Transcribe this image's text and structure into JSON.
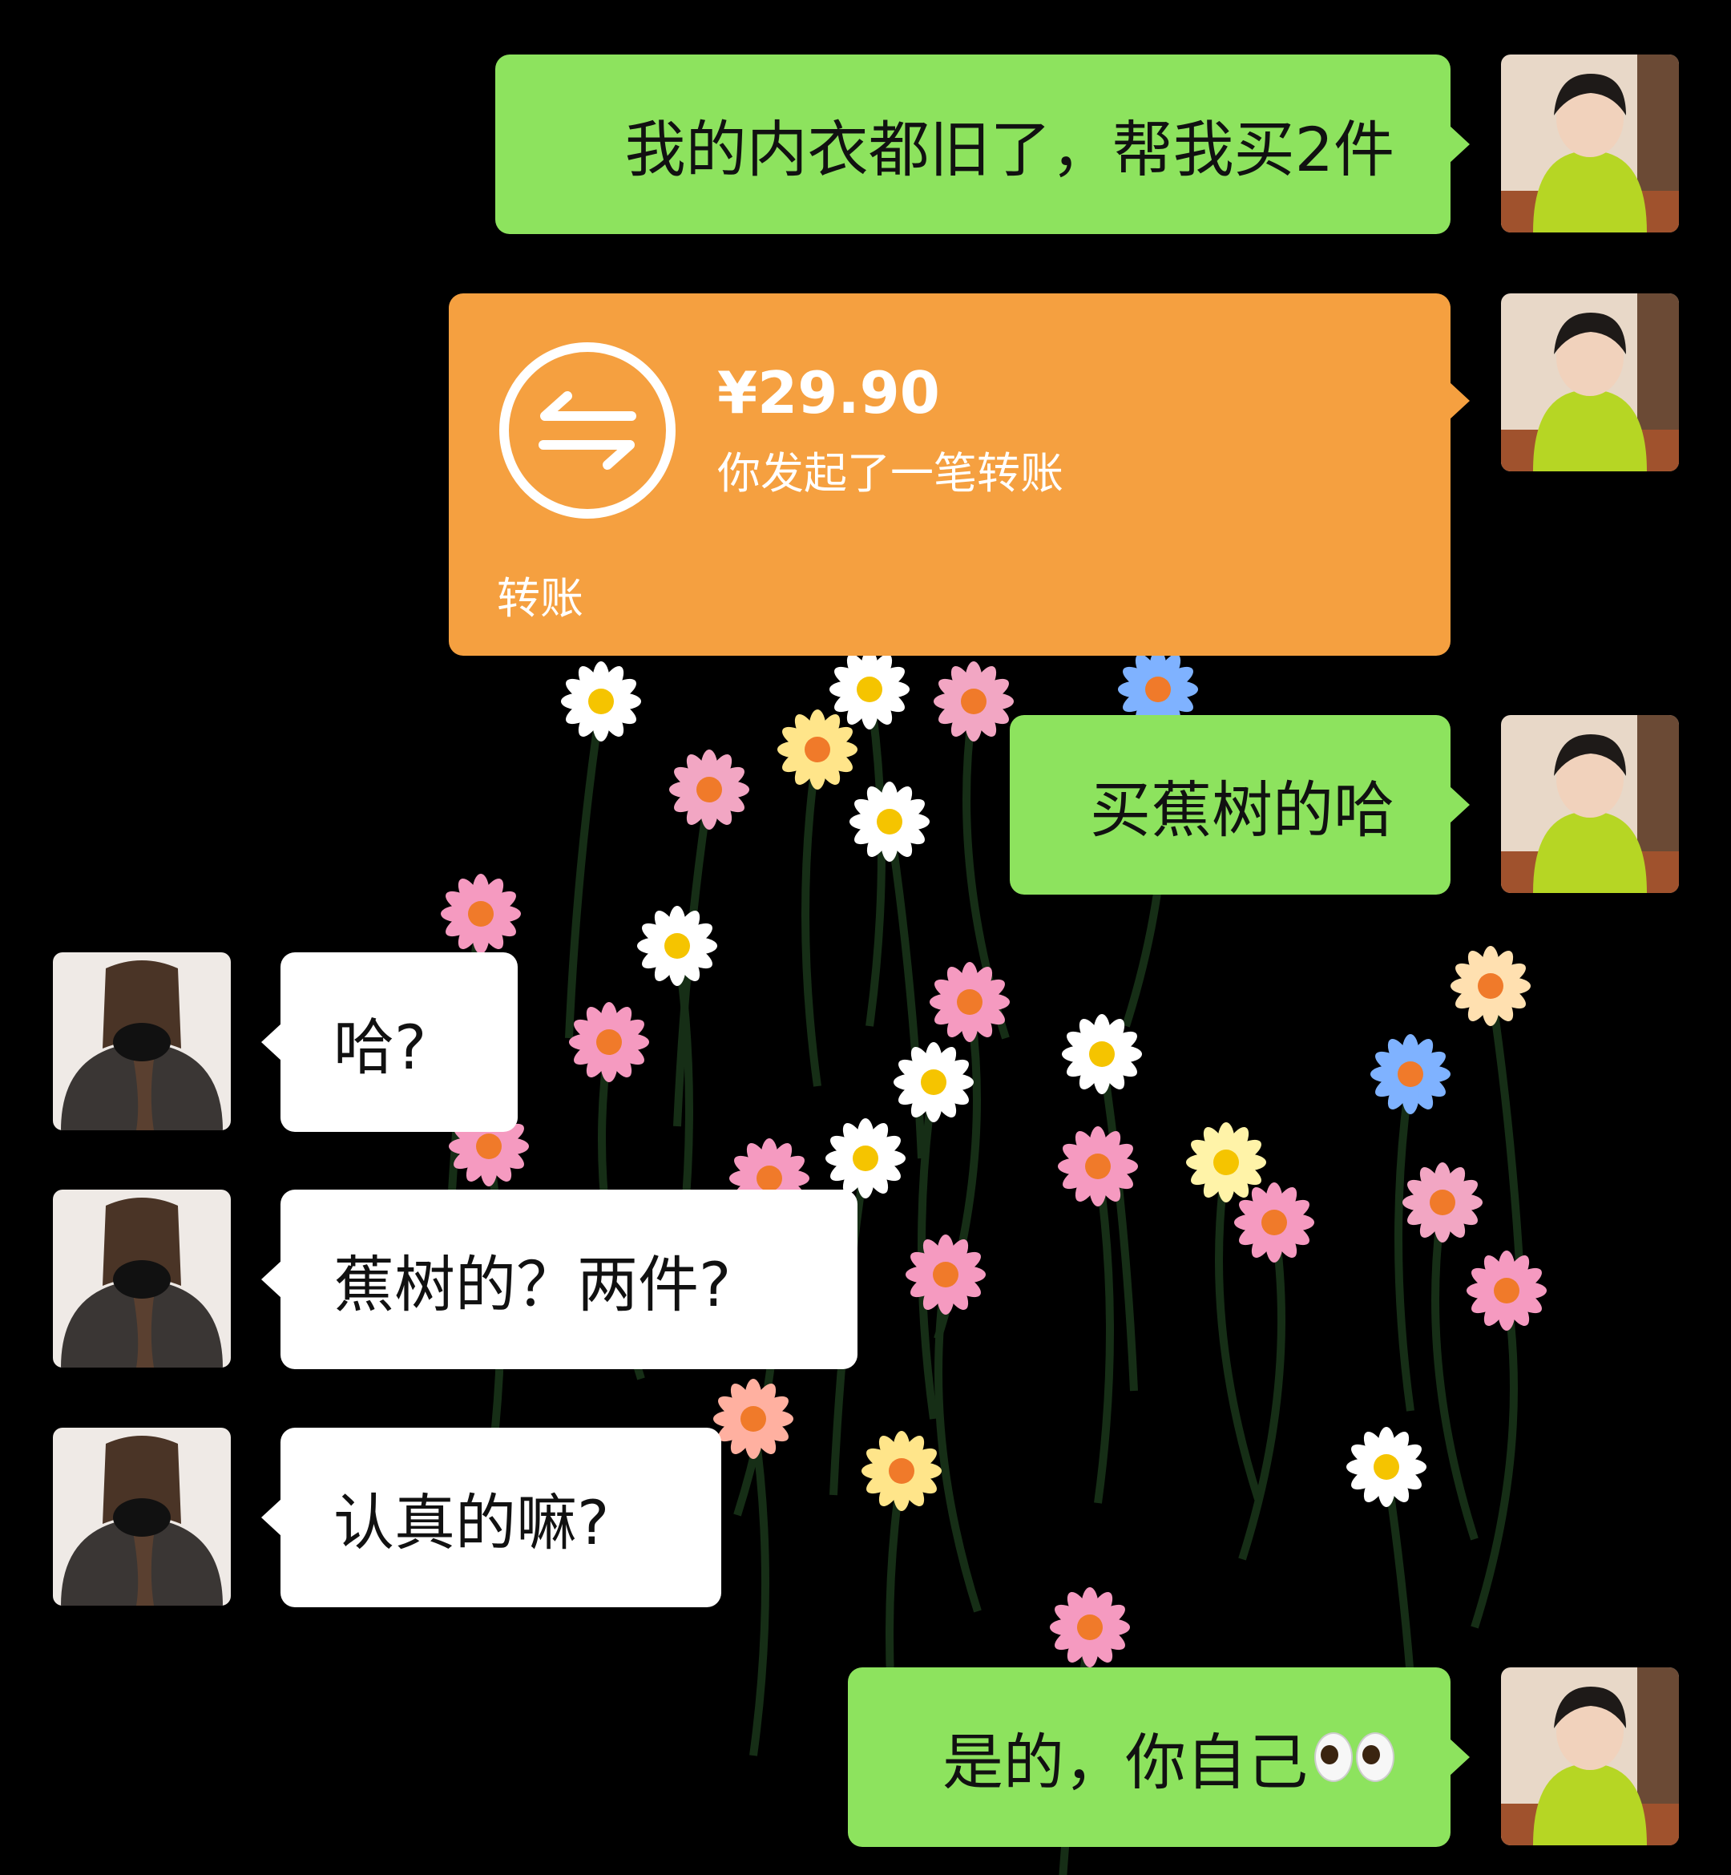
{
  "messages": [
    {
      "side": "right",
      "type": "text",
      "text": "我的内衣都旧了，帮我买2件"
    },
    {
      "side": "right",
      "type": "transfer",
      "amount": "¥29.90",
      "description": "你发起了一笔转账",
      "label": "转账"
    },
    {
      "side": "right",
      "type": "text",
      "text": "买蕉树的哈"
    },
    {
      "side": "left",
      "type": "text",
      "text": "哈?"
    },
    {
      "side": "left",
      "type": "text",
      "text": "蕉树的？两件?"
    },
    {
      "side": "left",
      "type": "text",
      "text": "认真的嘛?"
    },
    {
      "side": "right",
      "type": "text",
      "text": "是的，你自己",
      "emoji": "eyes"
    }
  ],
  "colors": {
    "background": "#000000",
    "sent_bubble": "#8de35e",
    "received_bubble": "#ffffff",
    "transfer_card": "#f5a040"
  }
}
